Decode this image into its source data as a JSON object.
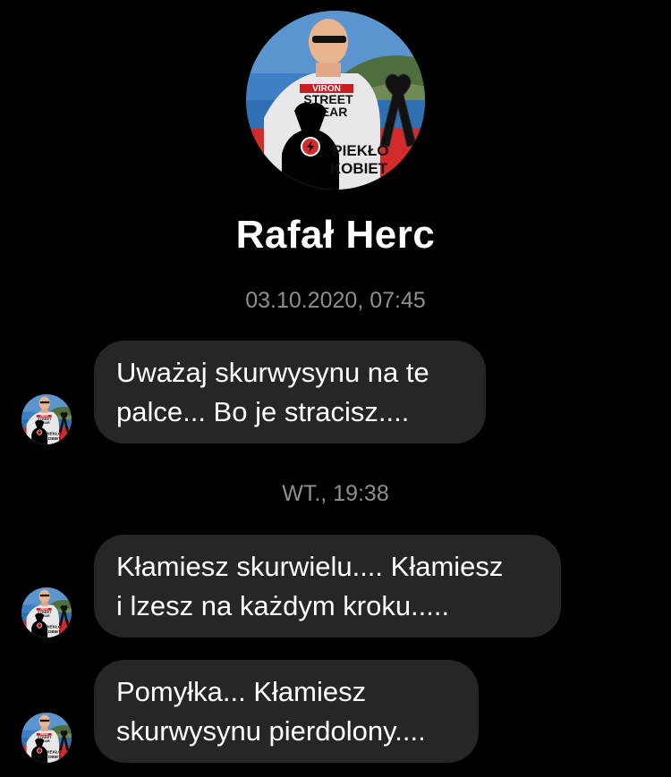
{
  "contact": {
    "name": "Rafał Herc",
    "avatar": {
      "icon": "profile-photo",
      "shirt_line1": "VIRON",
      "shirt_line2": "STREET",
      "shirt_line3": "WEAR",
      "banner_line1": "PIEKŁO",
      "banner_line2": "KOBIET",
      "badge_icon": "lightning-bolt-icon",
      "ribbon_icon": "black-ribbon-icon"
    }
  },
  "conversation": {
    "timestamps": [
      "03.10.2020, 07:45",
      "WT., 19:38"
    ],
    "messages": [
      {
        "lines": [
          "Uważaj skurwysynu na te",
          "palce... Bo je stracisz...."
        ]
      },
      {
        "lines": [
          "Kłamiesz skurwielu.... Kłamiesz",
          "i lzesz na każdym kroku....."
        ]
      },
      {
        "lines": [
          "Pomyłka... Kłamiesz",
          "skurwysynu pierdolony...."
        ]
      }
    ]
  },
  "colors": {
    "background": "#000000",
    "bubble": "#262628",
    "timestamp": "#8e8e93",
    "banner_red": "#d32a2a",
    "sky": "#3f7fc4"
  }
}
